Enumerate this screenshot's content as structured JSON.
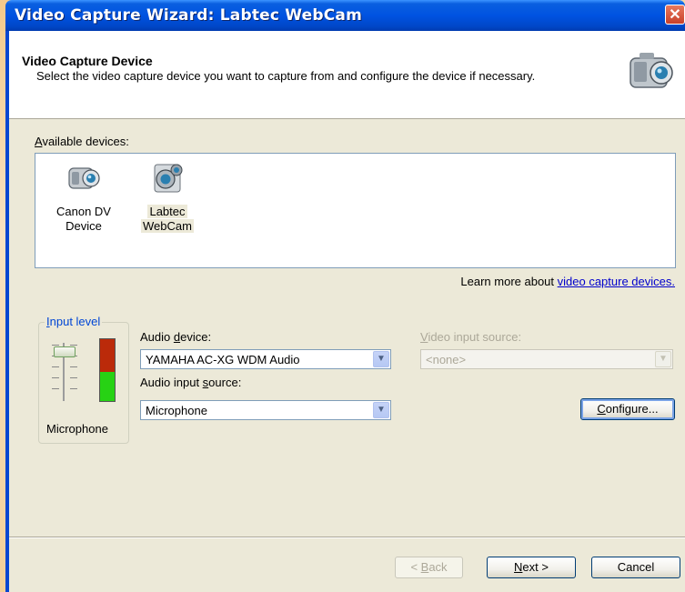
{
  "window": {
    "title": "Video Capture Wizard: Labtec WebCam",
    "close_glyph": "✕"
  },
  "header": {
    "title": "Video Capture Device",
    "subtitle": "Select the video capture device you want to capture from and configure the device if necessary.",
    "icon": "camcorder-icon"
  },
  "devices": {
    "label_pre": "",
    "label_key": "A",
    "label_post": "vailable devices:",
    "items": [
      {
        "line1": "Canon DV",
        "line2": "Device",
        "icon": "camcorder-icon",
        "selected": false
      },
      {
        "line1": "Labtec",
        "line2": "WebCam",
        "icon": "webcam-icon",
        "selected": true
      }
    ]
  },
  "learn_more": {
    "text": "Learn more about ",
    "link": "video capture devices."
  },
  "input_level": {
    "title_key": "I",
    "title_post": "nput level",
    "label": "Microphone"
  },
  "audio_device": {
    "label_pre": "Audio ",
    "label_key": "d",
    "label_post": "evice:",
    "value": "YAMAHA AC-XG WDM Audio"
  },
  "audio_input": {
    "label_pre": "Audio input ",
    "label_key": "s",
    "label_post": "ource:",
    "value": "Microphone"
  },
  "video_input": {
    "label_key": "V",
    "label_post": "ideo input source:",
    "value": "<none>"
  },
  "buttons": {
    "configure_key": "C",
    "configure_post": "onfigure...",
    "back_pre": "< ",
    "back_key": "B",
    "back_post": "ack",
    "next_key": "N",
    "next_post": "ext >",
    "cancel": "Cancel"
  },
  "colors": {
    "titlebar": "#0053e1",
    "dialog_bg": "#ece9d8",
    "link": "#0000cc",
    "meter_red": "#bb2a0a",
    "meter_green": "#27d214"
  }
}
